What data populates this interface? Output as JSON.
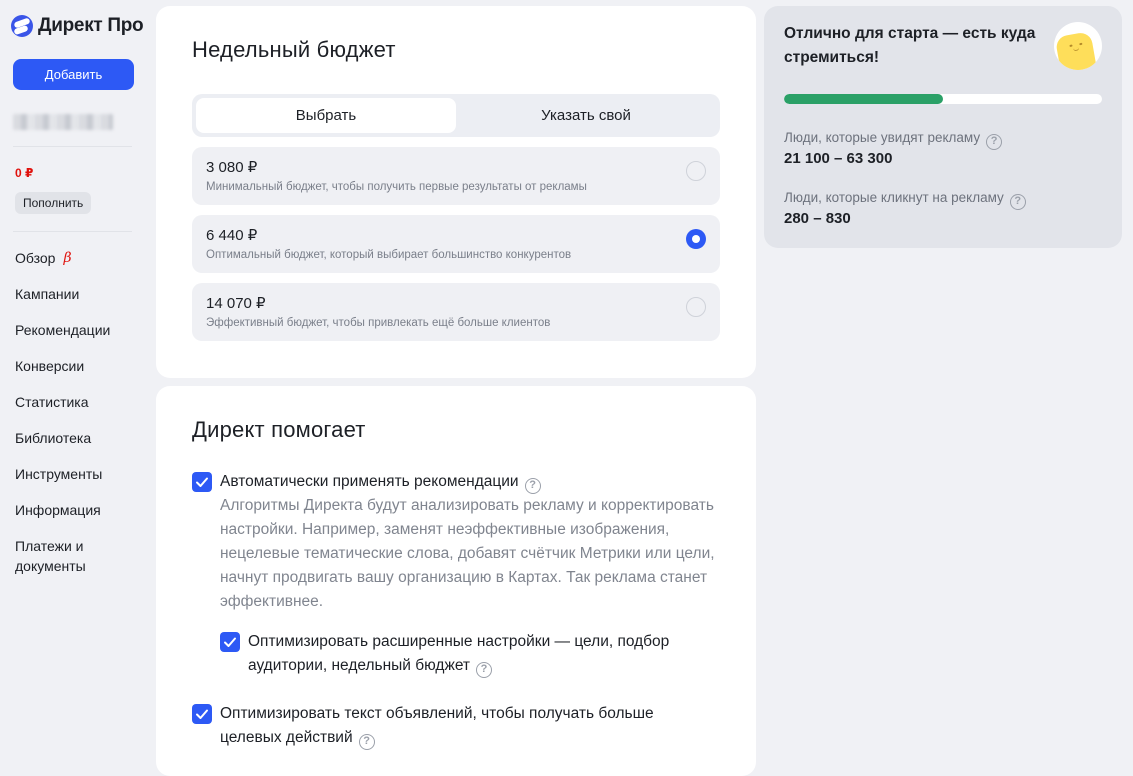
{
  "sidebar": {
    "logo_text": "Директ Про",
    "add_button": "Добавить",
    "balance": "0 ₽",
    "topup_button": "Пополнить",
    "items": [
      {
        "label": "Обзор",
        "badge": "β"
      },
      {
        "label": "Кампании"
      },
      {
        "label": "Рекомендации"
      },
      {
        "label": "Конверсии"
      },
      {
        "label": "Статистика"
      },
      {
        "label": "Библиотека"
      },
      {
        "label": "Инструменты"
      },
      {
        "label": "Информация"
      },
      {
        "label": "Платежи и документы"
      }
    ]
  },
  "budget": {
    "title": "Недельный бюджет",
    "tabs": [
      "Выбрать",
      "Указать свой"
    ],
    "options": [
      {
        "amount": "3 080 ₽",
        "desc": "Минимальный бюджет, чтобы получить первые результаты от рекламы",
        "selected": false
      },
      {
        "amount": "6 440 ₽",
        "desc": "Оптимальный бюджет, который выбирает большинство конкурентов",
        "selected": true
      },
      {
        "amount": "14 070 ₽",
        "desc": "Эффективный бюджет, чтобы привлекать ещё больше клиентов",
        "selected": false
      }
    ]
  },
  "helper": {
    "title": "Директ помогает",
    "auto_apply": {
      "label": "Автоматически применять рекомендации",
      "description": "Алгоритмы Директа будут анализировать рекламу и корректировать настройки. Например, заменят неэффективные изображения, нецелевые тематические слова, добавят счётчик Метрики или цели, начнут продвигать вашу организацию в Картах. Так реклама станет эффективнее.",
      "checked": true
    },
    "optimize_settings": {
      "label": "Оптимизировать расширенные настройки — цели, подбор аудитории, недельный бюджет",
      "checked": true
    },
    "optimize_text": {
      "label": "Оптимизировать текст объявлений, чтобы получать больше целевых действий",
      "checked": true
    }
  },
  "forecast": {
    "title": "Отлично для старта — есть куда стремиться!",
    "progress": 0.5,
    "progress_color": "#2aa067",
    "reach_label": "Люди, которые увидят рекламу",
    "reach_value": "21 100 – 63 300",
    "clicks_label": "Люди, которые кликнут на рекламу",
    "clicks_value": "280 – 830"
  },
  "colors": {
    "accent": "#2d59f5",
    "danger": "#e0110c",
    "background": "#f0f1f5"
  }
}
